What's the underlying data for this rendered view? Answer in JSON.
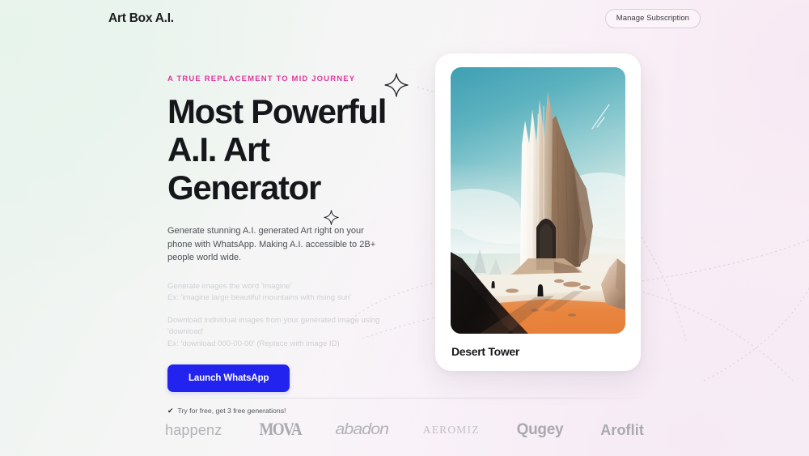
{
  "header": {
    "brand": "Art Box A.I.",
    "manage_label": "Manage Subscription"
  },
  "hero": {
    "eyebrow": "A TRUE REPLACEMENT TO MID JOURNEY",
    "headline_line1": "Most Powerful",
    "headline_line2": "A.I. Art",
    "headline_line3": "Generator",
    "lede": "Generate stunning A.I. generated Art right on your phone with WhatsApp. Making A.I. accessible to 2B+ people world wide.",
    "hint1_line1": "Generate images the word 'Imagine'",
    "hint1_line2": "Ex: 'imagine large beautiful mountains with rising sun'",
    "hint2_line1": "Download individual images from your generated image using 'download'",
    "hint2_line2": "Ex: 'download 000-00-00' (Replace with image ID)",
    "cta_label": "Launch WhatsApp",
    "free_note": "Try for free, get 3 free generations!",
    "check_glyph": "✔"
  },
  "card": {
    "title": "Desert Tower",
    "artwork_alt": "desert-tower-artwork"
  },
  "logos": [
    {
      "name": "happenz",
      "label": "happenz"
    },
    {
      "name": "mova",
      "label": "MOVA"
    },
    {
      "name": "abadon",
      "label": "abadon"
    },
    {
      "name": "aeromiz",
      "label": "AEROMIZ"
    },
    {
      "name": "qugey",
      "label": "Qugey"
    },
    {
      "name": "aroflit",
      "label": "Aroflit"
    }
  ],
  "colors": {
    "accent_pink": "#e0359c",
    "cta_blue": "#2323f0",
    "text_dark": "#15171a",
    "muted": "#cfd0d4"
  }
}
